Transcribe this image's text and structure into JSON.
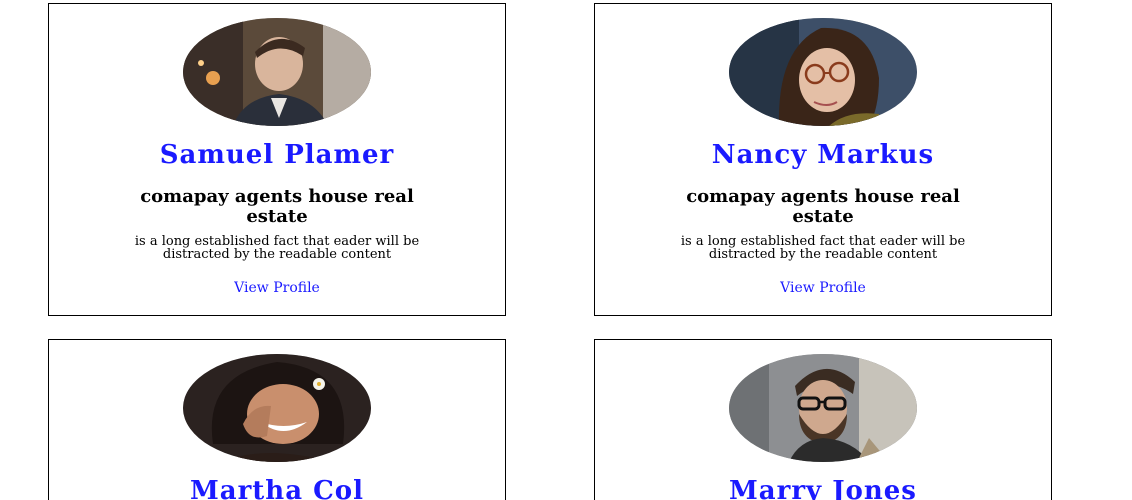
{
  "cards": [
    {
      "name": "Samuel Plamer",
      "company": "comapay agents house real estate",
      "description": "is a long established fact that eader will be distracted by the readable content",
      "link_label": "View Profile"
    },
    {
      "name": "Nancy Markus",
      "company": "comapay agents house real estate",
      "description": "is a long established fact that eader will be distracted by the readable content",
      "link_label": "View Profile"
    },
    {
      "name": "Martha Col",
      "company": "",
      "description": "",
      "link_label": ""
    },
    {
      "name": "Marry Jones",
      "company": "",
      "description": "",
      "link_label": ""
    }
  ],
  "colors": {
    "name": "#1a1aff",
    "link": "#1a1aff",
    "border": "#000000"
  },
  "icons": {
    "avatar_1": "portrait-photo",
    "avatar_2": "portrait-photo",
    "avatar_3": "portrait-photo",
    "avatar_4": "portrait-photo"
  }
}
